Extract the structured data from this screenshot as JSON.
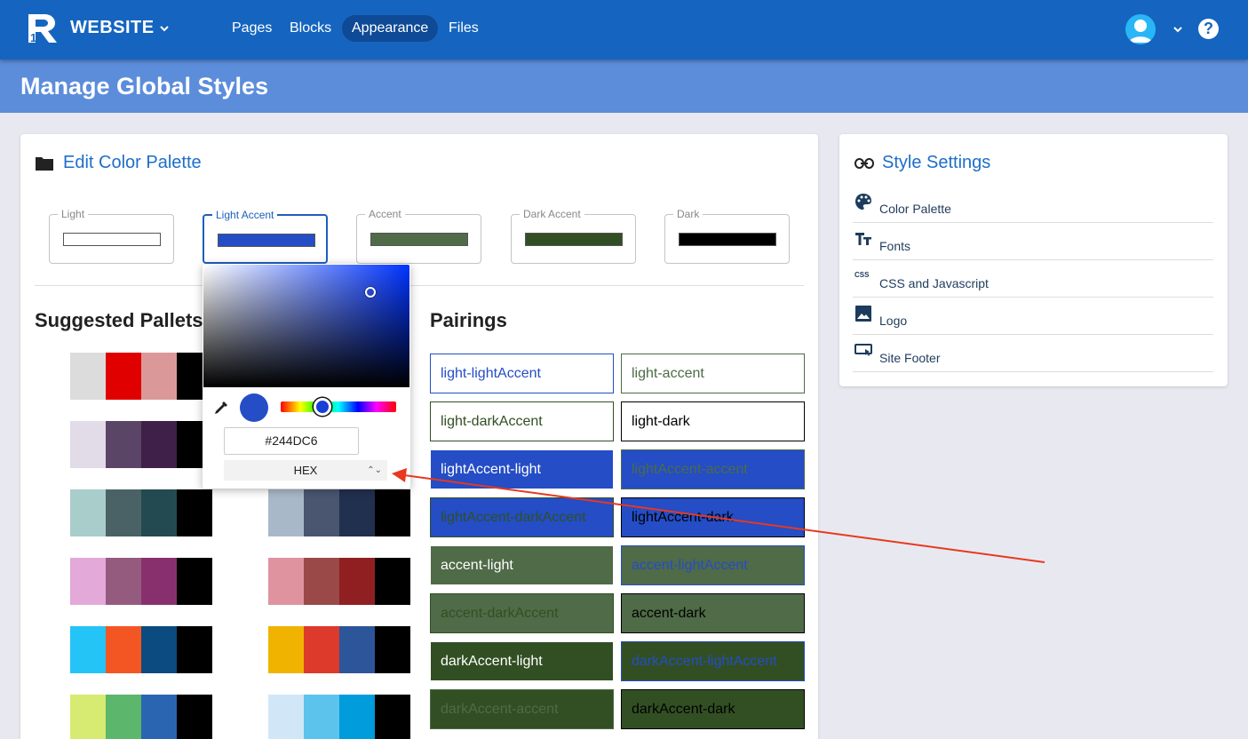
{
  "app": {
    "brand": "WEBSITE",
    "nav": [
      "Pages",
      "Blocks",
      "Appearance",
      "Files"
    ],
    "active_nav": "Appearance"
  },
  "page": {
    "title": "Manage Global Styles"
  },
  "palette_editor": {
    "title": "Edit Color Palette",
    "swatches": [
      {
        "label": "Light",
        "color": "#ffffff"
      },
      {
        "label": "Light Accent",
        "color": "#244dc6"
      },
      {
        "label": "Accent",
        "color": "#4f6b47"
      },
      {
        "label": "Dark Accent",
        "color": "#324f23"
      },
      {
        "label": "Dark",
        "color": "#000000"
      }
    ],
    "focused_swatch": "Light Accent"
  },
  "suggested": {
    "title": "Suggested Pallets",
    "left_column": [
      [
        "#ffffff",
        "#dcdcdc",
        "#e00000",
        "#db9898",
        "#000000"
      ],
      [
        "#ffffff",
        "#e2dbe8",
        "#5b4567",
        "#3f2048",
        "#000000"
      ],
      [
        "#ffffff",
        "#a9cdcb",
        "#4a6266",
        "#234a50",
        "#000000"
      ],
      [
        "#ffffff",
        "#e2a9d9",
        "#955b7e",
        "#88306e",
        "#000000"
      ],
      [
        "#ffffff",
        "#24c4f6",
        "#f45623",
        "#0b4b7f",
        "#000000"
      ],
      [
        "#ffffff",
        "#d7ea72",
        "#5cb66b",
        "#2a65b1",
        "#000000"
      ]
    ],
    "right_column": [
      [
        "#ffffff",
        "#e5e5e5",
        "#e5e5e5",
        "#e5e5e5",
        "#000000"
      ],
      [
        "#ffffff",
        "#e5e5e5",
        "#e5e5e5",
        "#e5e5e5",
        "#000000"
      ],
      [
        "#ffffff",
        "#a9b8c9",
        "#4a5670",
        "#22304f",
        "#000000"
      ],
      [
        "#ffffff",
        "#de939f",
        "#9a4848",
        "#901f22",
        "#000000"
      ],
      [
        "#ffffff",
        "#f0b400",
        "#de3a2b",
        "#2d5599",
        "#000000"
      ],
      [
        "#ffffff",
        "#d1e7f8",
        "#5cc4ec",
        "#019cdb",
        "#000000"
      ]
    ]
  },
  "pairings": {
    "title": "Pairings",
    "items": [
      {
        "label": "light-lightAccent",
        "bg": "#ffffff",
        "fg": "#244dc6"
      },
      {
        "label": "light-accent",
        "bg": "#ffffff",
        "fg": "#4f6b47"
      },
      {
        "label": "light-darkAccent",
        "bg": "#ffffff",
        "fg": "#324f23"
      },
      {
        "label": "light-dark",
        "bg": "#ffffff",
        "fg": "#000000"
      },
      {
        "label": "lightAccent-light",
        "bg": "#244dc6",
        "fg": "#ffffff"
      },
      {
        "label": "lightAccent-accent",
        "bg": "#244dc6",
        "fg": "#4f6b47"
      },
      {
        "label": "lightAccent-darkAccent",
        "bg": "#244dc6",
        "fg": "#324f23"
      },
      {
        "label": "lightAccent-dark",
        "bg": "#244dc6",
        "fg": "#000000"
      },
      {
        "label": "accent-light",
        "bg": "#4f6b47",
        "fg": "#ffffff"
      },
      {
        "label": "accent-lightAccent",
        "bg": "#4f6b47",
        "fg": "#244dc6"
      },
      {
        "label": "accent-darkAccent",
        "bg": "#4f6b47",
        "fg": "#324f23"
      },
      {
        "label": "accent-dark",
        "bg": "#4f6b47",
        "fg": "#000000"
      },
      {
        "label": "darkAccent-light",
        "bg": "#324f23",
        "fg": "#ffffff"
      },
      {
        "label": "darkAccent-lightAccent",
        "bg": "#324f23",
        "fg": "#244dc6"
      },
      {
        "label": "darkAccent-accent",
        "bg": "#324f23",
        "fg": "#4f6b47"
      },
      {
        "label": "darkAccent-dark",
        "bg": "#324f23",
        "fg": "#000000"
      }
    ]
  },
  "picker": {
    "hex_value": "#244DC6",
    "mode": "HEX",
    "preview_color": "#244dc6"
  },
  "style_settings": {
    "title": "Style Settings",
    "items": [
      {
        "label": "Color Palette",
        "icon": "palette-icon"
      },
      {
        "label": "Fonts",
        "icon": "text-fields-icon"
      },
      {
        "label": "CSS and Javascript",
        "icon": "css-icon"
      },
      {
        "label": "Logo",
        "icon": "image-icon"
      },
      {
        "label": "Site Footer",
        "icon": "footer-icon"
      }
    ]
  }
}
